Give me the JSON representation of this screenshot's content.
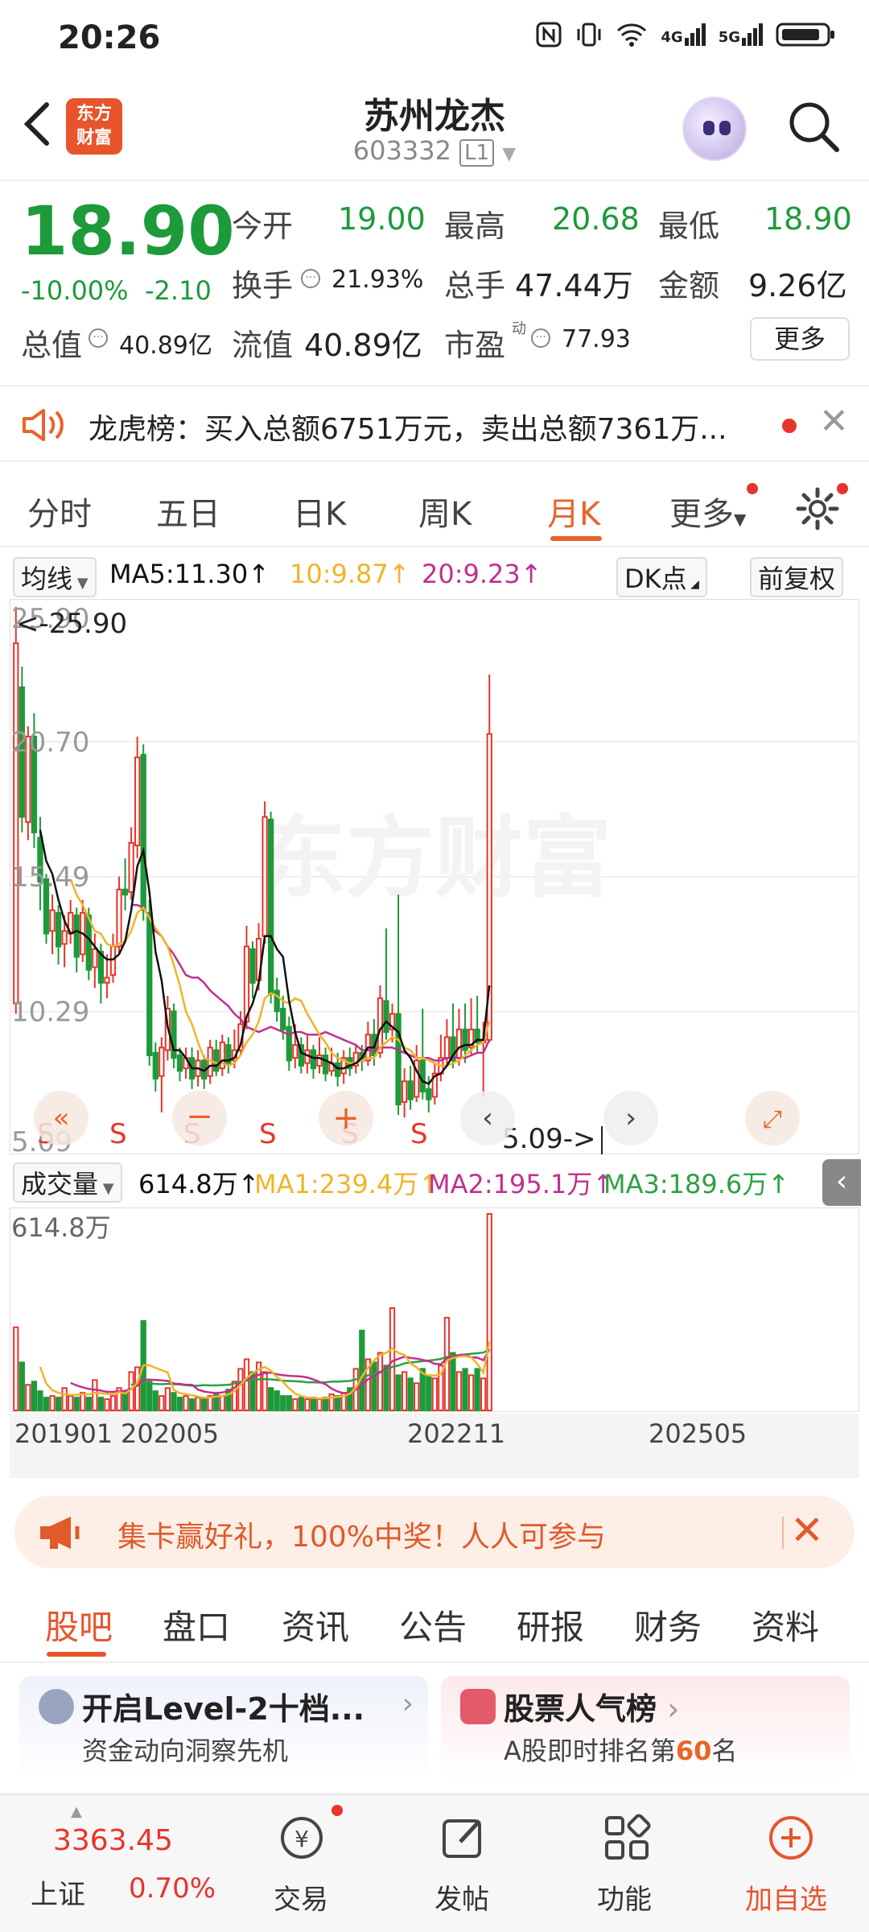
{
  "status_bar": {
    "time": "20:26",
    "icons": [
      "nfc-icon",
      "vibrate-icon",
      "wifi-icon",
      "4g-signal-icon",
      "5g-signal-icon",
      "battery-icon"
    ],
    "net1": "4G",
    "net2": "5G"
  },
  "header": {
    "logo_line1": "东方",
    "logo_line2": "财富",
    "title": "苏州龙杰",
    "code": "603332",
    "level": "L1"
  },
  "quote": {
    "price": "18.90",
    "change_pct": "-10.00%",
    "change_abs": "-2.10",
    "open_label": "今开",
    "open": "19.00",
    "high_label": "最高",
    "high": "20.68",
    "low_label": "最低",
    "low": "18.90",
    "turnover_label": "换手",
    "turnover": "21.93%",
    "volume_label": "总手",
    "volume": "47.44万",
    "amount_label": "金额",
    "amount": "9.26亿",
    "mktcap_label": "总值",
    "mktcap": "40.89亿",
    "float_label": "流值",
    "float": "40.89亿",
    "pe_label": "市盈",
    "pe_sup": "动",
    "pe": "77.93",
    "more": "更多"
  },
  "banner": {
    "text": "龙虎榜：买入总额6751万元，卖出总额7361万..."
  },
  "period_tabs": {
    "items": [
      "分时",
      "五日",
      "日K",
      "周K",
      "月K",
      "更多"
    ],
    "active": "月K"
  },
  "ma_legend": {
    "selector": "均线",
    "ma5": "MA5:11.30↑",
    "ma10": "10:9.87↑",
    "ma20": "20:9.23↑",
    "dk": "DK点",
    "adjust": "前复权"
  },
  "chart_data": {
    "type": "candlestick",
    "period": "monthly",
    "y_ticks": [
      "25.90",
      "20.70",
      "15.49",
      "10.29",
      "5.09"
    ],
    "ylim": [
      5.09,
      25.9
    ],
    "max_marker": "<-25.90",
    "min_marker": "5.09->",
    "signals": [
      "S",
      "S",
      "S",
      "S",
      "S",
      "S"
    ],
    "x_labels": [
      "201901",
      "202005",
      "202211",
      "202505"
    ],
    "watermark": "东方财富",
    "candles": [
      {
        "o": 10.6,
        "c": 24.5,
        "h": 25.9,
        "l": 10.2
      },
      {
        "o": 22.8,
        "c": 17.8,
        "h": 23.6,
        "l": 17.2
      },
      {
        "o": 17.6,
        "c": 20.9,
        "h": 21.3,
        "l": 16.9
      },
      {
        "o": 20.9,
        "c": 17.2,
        "h": 21.8,
        "l": 16.6
      },
      {
        "o": 17.0,
        "c": 15.3,
        "h": 17.8,
        "l": 14.2
      },
      {
        "o": 15.4,
        "c": 13.3,
        "h": 15.6,
        "l": 12.9
      },
      {
        "o": 13.4,
        "c": 14.2,
        "h": 14.8,
        "l": 12.5
      },
      {
        "o": 14.1,
        "c": 12.8,
        "h": 14.4,
        "l": 12.1
      },
      {
        "o": 12.9,
        "c": 13.4,
        "h": 14.0,
        "l": 12.0
      },
      {
        "o": 13.3,
        "c": 14.1,
        "h": 14.6,
        "l": 12.9
      },
      {
        "o": 14.0,
        "c": 12.4,
        "h": 14.3,
        "l": 11.8
      },
      {
        "o": 12.5,
        "c": 14.1,
        "h": 14.6,
        "l": 12.2
      },
      {
        "o": 14.0,
        "c": 11.9,
        "h": 14.3,
        "l": 11.5
      },
      {
        "o": 12.0,
        "c": 12.7,
        "h": 13.3,
        "l": 11.2
      },
      {
        "o": 12.6,
        "c": 11.4,
        "h": 12.9,
        "l": 10.6
      },
      {
        "o": 11.4,
        "c": 11.6,
        "h": 12.5,
        "l": 10.8
      },
      {
        "o": 11.7,
        "c": 12.8,
        "h": 13.3,
        "l": 11.4
      },
      {
        "o": 12.8,
        "c": 15.0,
        "h": 15.5,
        "l": 12.5
      },
      {
        "o": 15.0,
        "c": 14.8,
        "h": 16.2,
        "l": 14.2
      },
      {
        "o": 14.9,
        "c": 16.8,
        "h": 17.4,
        "l": 14.6
      },
      {
        "o": 16.7,
        "c": 20.1,
        "h": 20.9,
        "l": 16.2
      },
      {
        "o": 20.2,
        "c": 14.2,
        "h": 20.6,
        "l": 13.8
      },
      {
        "o": 14.1,
        "c": 8.6,
        "h": 14.6,
        "l": 8.2
      },
      {
        "o": 8.7,
        "c": 7.7,
        "h": 9.1,
        "l": 7.2
      },
      {
        "o": 7.8,
        "c": 8.9,
        "h": 9.3,
        "l": 6.4
      },
      {
        "o": 8.8,
        "c": 10.4,
        "h": 10.9,
        "l": 8.4
      },
      {
        "o": 10.3,
        "c": 8.5,
        "h": 10.6,
        "l": 8.1
      },
      {
        "o": 8.6,
        "c": 8.0,
        "h": 8.9,
        "l": 7.6
      },
      {
        "o": 8.1,
        "c": 8.5,
        "h": 8.9,
        "l": 7.7
      },
      {
        "o": 8.5,
        "c": 7.7,
        "h": 8.9,
        "l": 7.3
      },
      {
        "o": 7.8,
        "c": 8.4,
        "h": 8.8,
        "l": 7.4
      },
      {
        "o": 8.4,
        "c": 7.7,
        "h": 8.6,
        "l": 7.3
      },
      {
        "o": 7.8,
        "c": 8.9,
        "h": 9.2,
        "l": 7.5
      },
      {
        "o": 8.8,
        "c": 8.0,
        "h": 9.2,
        "l": 7.8
      },
      {
        "o": 8.1,
        "c": 9.1,
        "h": 9.4,
        "l": 7.8
      },
      {
        "o": 9.0,
        "c": 8.3,
        "h": 9.3,
        "l": 7.9
      },
      {
        "o": 8.4,
        "c": 8.8,
        "h": 9.6,
        "l": 8.1
      },
      {
        "o": 8.8,
        "c": 9.8,
        "h": 10.3,
        "l": 8.6
      },
      {
        "o": 9.9,
        "c": 12.8,
        "h": 13.6,
        "l": 9.6
      },
      {
        "o": 12.7,
        "c": 11.4,
        "h": 13.0,
        "l": 10.8
      },
      {
        "o": 11.5,
        "c": 13.1,
        "h": 13.7,
        "l": 11.1
      },
      {
        "o": 13.2,
        "c": 17.8,
        "h": 18.4,
        "l": 12.9
      },
      {
        "o": 17.7,
        "c": 11.0,
        "h": 18.0,
        "l": 10.6
      },
      {
        "o": 11.1,
        "c": 10.3,
        "h": 11.6,
        "l": 9.9
      },
      {
        "o": 10.4,
        "c": 9.6,
        "h": 10.9,
        "l": 9.2
      },
      {
        "o": 9.7,
        "c": 8.4,
        "h": 10.1,
        "l": 8.0
      },
      {
        "o": 8.5,
        "c": 9.0,
        "h": 9.8,
        "l": 8.1
      },
      {
        "o": 9.0,
        "c": 8.2,
        "h": 9.3,
        "l": 7.9
      },
      {
        "o": 8.3,
        "c": 8.8,
        "h": 9.4,
        "l": 7.9
      },
      {
        "o": 8.8,
        "c": 8.1,
        "h": 9.0,
        "l": 7.7
      },
      {
        "o": 8.2,
        "c": 8.6,
        "h": 9.3,
        "l": 7.9
      },
      {
        "o": 8.6,
        "c": 7.9,
        "h": 8.9,
        "l": 7.6
      },
      {
        "o": 8.0,
        "c": 8.3,
        "h": 8.9,
        "l": 7.8
      },
      {
        "o": 8.3,
        "c": 7.8,
        "h": 8.7,
        "l": 7.4
      },
      {
        "o": 7.9,
        "c": 8.5,
        "h": 8.8,
        "l": 7.5
      },
      {
        "o": 8.5,
        "c": 8.1,
        "h": 8.9,
        "l": 7.8
      },
      {
        "o": 8.2,
        "c": 8.7,
        "h": 9.0,
        "l": 7.9
      },
      {
        "o": 8.7,
        "c": 8.4,
        "h": 9.0,
        "l": 8.0
      },
      {
        "o": 8.4,
        "c": 9.4,
        "h": 9.9,
        "l": 8.2
      },
      {
        "o": 9.4,
        "c": 8.6,
        "h": 10.0,
        "l": 8.2
      },
      {
        "o": 8.7,
        "c": 10.8,
        "h": 11.3,
        "l": 8.5
      },
      {
        "o": 10.7,
        "c": 9.5,
        "h": 13.5,
        "l": 9.2
      },
      {
        "o": 9.6,
        "c": 10.2,
        "h": 10.6,
        "l": 9.1
      },
      {
        "o": 10.2,
        "c": 6.7,
        "h": 14.8,
        "l": 6.3
      },
      {
        "o": 6.8,
        "c": 7.6,
        "h": 8.1,
        "l": 6.2
      },
      {
        "o": 7.6,
        "c": 6.9,
        "h": 8.2,
        "l": 6.5
      },
      {
        "o": 7.0,
        "c": 8.4,
        "h": 9.0,
        "l": 6.8
      },
      {
        "o": 8.4,
        "c": 7.2,
        "h": 10.4,
        "l": 6.9
      },
      {
        "o": 7.3,
        "c": 6.9,
        "h": 7.8,
        "l": 6.4
      },
      {
        "o": 7.0,
        "c": 7.9,
        "h": 8.3,
        "l": 6.7
      },
      {
        "o": 7.9,
        "c": 8.5,
        "h": 9.4,
        "l": 7.6
      },
      {
        "o": 8.5,
        "c": 9.3,
        "h": 10.0,
        "l": 8.2
      },
      {
        "o": 9.3,
        "c": 8.4,
        "h": 10.6,
        "l": 8.1
      },
      {
        "o": 8.5,
        "c": 9.6,
        "h": 10.4,
        "l": 8.2
      },
      {
        "o": 9.6,
        "c": 8.8,
        "h": 10.6,
        "l": 8.3
      },
      {
        "o": 8.9,
        "c": 9.6,
        "h": 10.8,
        "l": 8.6
      },
      {
        "o": 9.6,
        "c": 9.1,
        "h": 10.9,
        "l": 8.7
      },
      {
        "o": 9.1,
        "c": 9.2,
        "h": 9.9,
        "l": 7.0
      },
      {
        "o": 9.2,
        "c": 21.0,
        "h": 23.3,
        "l": 9.1
      }
    ],
    "ma5": [
      null,
      null,
      null,
      null,
      17.3,
      16.1,
      15.6,
      14.6,
      13.8,
      13.3,
      13.4,
      13.3,
      13.1,
      12.8,
      12.5,
      12.3,
      12.3,
      12.5,
      13.0,
      14.2,
      15.9,
      16.5,
      14.9,
      12.6,
      11.5,
      9.7,
      8.8,
      8.8,
      8.5,
      8.1,
      8.1,
      8.0,
      8.2,
      8.2,
      8.4,
      8.4,
      8.5,
      9.0,
      10.1,
      10.6,
      11.4,
      13.2,
      13.2,
      12.7,
      12.4,
      10.7,
      9.5,
      8.7,
      8.6,
      8.5,
      8.5,
      8.4,
      8.3,
      8.1,
      8.1,
      8.2,
      8.3,
      8.5,
      8.9,
      8.9,
      9.6,
      9.9,
      9.7,
      9.5,
      8.8,
      8.5,
      8.0,
      7.6,
      7.5,
      7.8,
      7.9,
      8.2,
      8.6,
      8.9,
      9.0,
      9.0,
      9.2,
      9.2,
      11.3
    ],
    "ma10": [
      null,
      null,
      null,
      null,
      null,
      null,
      null,
      null,
      null,
      15.4,
      14.8,
      14.4,
      13.9,
      13.4,
      13.3,
      12.9,
      12.8,
      12.9,
      13.0,
      13.4,
      14.1,
      14.3,
      13.9,
      13.5,
      13.2,
      12.8,
      12.1,
      11.3,
      10.3,
      9.8,
      9.1,
      8.5,
      8.4,
      8.3,
      8.3,
      8.2,
      8.3,
      8.6,
      9.1,
      9.4,
      9.9,
      10.8,
      11.0,
      10.9,
      10.7,
      10.6,
      10.8,
      10.7,
      10.2,
      9.8,
      9.4,
      9.1,
      8.7,
      8.5,
      8.4,
      8.3,
      8.3,
      8.4,
      8.5,
      8.5,
      8.9,
      9.1,
      9.3,
      9.2,
      8.9,
      8.8,
      8.5,
      8.5,
      8.4,
      8.3,
      8.2,
      8.2,
      8.3,
      8.4,
      8.6,
      8.8,
      9.0,
      9.1,
      9.9
    ],
    "ma20": [
      null,
      null,
      null,
      null,
      null,
      null,
      null,
      null,
      null,
      null,
      null,
      null,
      null,
      null,
      null,
      null,
      null,
      null,
      null,
      14.4,
      14.4,
      14.3,
      13.9,
      13.4,
      13.2,
      12.8,
      12.5,
      12.1,
      11.7,
      11.6,
      11.6,
      11.4,
      11.1,
      10.9,
      10.7,
      10.5,
      10.2,
      10.0,
      9.7,
      9.6,
      9.5,
      9.6,
      9.7,
      9.6,
      9.5,
      9.4,
      9.5,
      9.5,
      9.4,
      9.4,
      9.4,
      9.5,
      9.4,
      9.3,
      9.2,
      9.1,
      9.0,
      8.8,
      8.8,
      8.8,
      8.9,
      8.9,
      8.9,
      8.8,
      8.7,
      8.6,
      8.5,
      8.5,
      8.5,
      8.4,
      8.4,
      8.5,
      8.5,
      8.5,
      8.5,
      8.6,
      8.7,
      8.7,
      9.2
    ]
  },
  "volume": {
    "selector": "成交量",
    "current": "614.8万↑",
    "ma1": "MA1:239.4万↑",
    "ma2": "MA2:195.1万↑",
    "ma3": "MA3:189.6万↑",
    "y_top": "614.8万",
    "ylim": [
      0,
      614.8
    ],
    "values": [
      260,
      150,
      80,
      90,
      60,
      40,
      45,
      40,
      70,
      45,
      40,
      55,
      40,
      95,
      40,
      35,
      45,
      70,
      60,
      120,
      135,
      280,
      90,
      60,
      45,
      70,
      55,
      40,
      45,
      35,
      40,
      40,
      45,
      55,
      45,
      65,
      90,
      130,
      160,
      120,
      150,
      120,
      70,
      60,
      45,
      45,
      35,
      40,
      35,
      40,
      35,
      40,
      50,
      45,
      55,
      70,
      130,
      250,
      160,
      150,
      180,
      140,
      320,
      110,
      120,
      100,
      85,
      130,
      110,
      100,
      140,
      290,
      180,
      120,
      130,
      110,
      130,
      100,
      614.8
    ],
    "ma1_line": [
      null,
      null,
      null,
      null,
      136,
      84,
      63,
      55,
      51,
      48,
      48,
      51,
      50,
      55,
      54,
      51,
      51,
      57,
      53,
      66,
      86,
      141,
      141,
      133,
      126,
      119,
      64,
      54,
      51,
      47,
      43,
      39,
      41,
      43,
      45,
      50,
      60,
      81,
      101,
      117,
      128,
      136,
      124,
      104,
      89,
      69,
      53,
      45,
      40,
      39,
      37,
      38,
      40,
      42,
      45,
      52,
      70,
      106,
      133,
      156,
      174,
      180,
      194,
      180,
      174,
      147,
      135,
      116,
      109,
      109,
      113,
      156,
      164,
      168,
      170,
      166,
      146,
      118,
      215
    ],
    "ma2_line": [
      null,
      null,
      null,
      null,
      null,
      null,
      null,
      null,
      null,
      86,
      78,
      72,
      67,
      65,
      62,
      58,
      58,
      60,
      61,
      68,
      77,
      96,
      96,
      95,
      94,
      92,
      84,
      83,
      80,
      80,
      65,
      59,
      56,
      54,
      56,
      61,
      71,
      87,
      97,
      105,
      111,
      117,
      118,
      113,
      110,
      108,
      107,
      106,
      103,
      97,
      89,
      82,
      68,
      59,
      54,
      55,
      64,
      81,
      97,
      107,
      119,
      131,
      154,
      161,
      168,
      164,
      162,
      158,
      154,
      146,
      144,
      163,
      168,
      173,
      174,
      166,
      165,
      157,
      191
    ],
    "ma3_line": [
      null,
      null,
      null,
      null,
      null,
      null,
      null,
      null,
      null,
      null,
      null,
      null,
      null,
      null,
      null,
      null,
      null,
      null,
      null,
      80,
      82,
      84,
      84,
      83,
      82,
      83,
      82,
      81,
      79,
      77,
      77,
      79,
      78,
      78,
      79,
      80,
      84,
      89,
      93,
      96,
      97,
      98,
      97,
      95,
      93,
      92,
      91,
      90,
      88,
      88,
      87,
      88,
      90,
      90,
      91,
      92,
      97,
      104,
      109,
      114,
      121,
      127,
      136,
      140,
      147,
      150,
      152,
      154,
      156,
      158,
      161,
      167,
      170,
      173,
      175,
      177,
      179,
      181,
      190
    ]
  },
  "promo": {
    "text": "集卡赢好礼，100%中奖！人人可参与"
  },
  "content_tabs": {
    "items": [
      "股吧",
      "盘口",
      "资讯",
      "公告",
      "研报",
      "财务",
      "资料"
    ],
    "active": "股吧"
  },
  "cards": [
    {
      "title": "开启Level-2十档...",
      "subtitle": "资金动向洞察先机"
    },
    {
      "title": "股票人气榜",
      "subtitle_prefix": "A股即时排名第",
      "rank": "60",
      "subtitle_suffix": "名"
    }
  ],
  "bottom_nav": {
    "index_value": "3363.45",
    "index_name": "上证",
    "index_change": "0.70%",
    "items": [
      "交易",
      "发帖",
      "功能",
      "加自选"
    ]
  },
  "colors": {
    "up": "#e8342b",
    "down": "#1d9a3a",
    "accent": "#e8642b",
    "ma5": "#111111",
    "ma10": "#f0b429",
    "ma20": "#c0308f",
    "vol_ma3": "#2ea043"
  }
}
